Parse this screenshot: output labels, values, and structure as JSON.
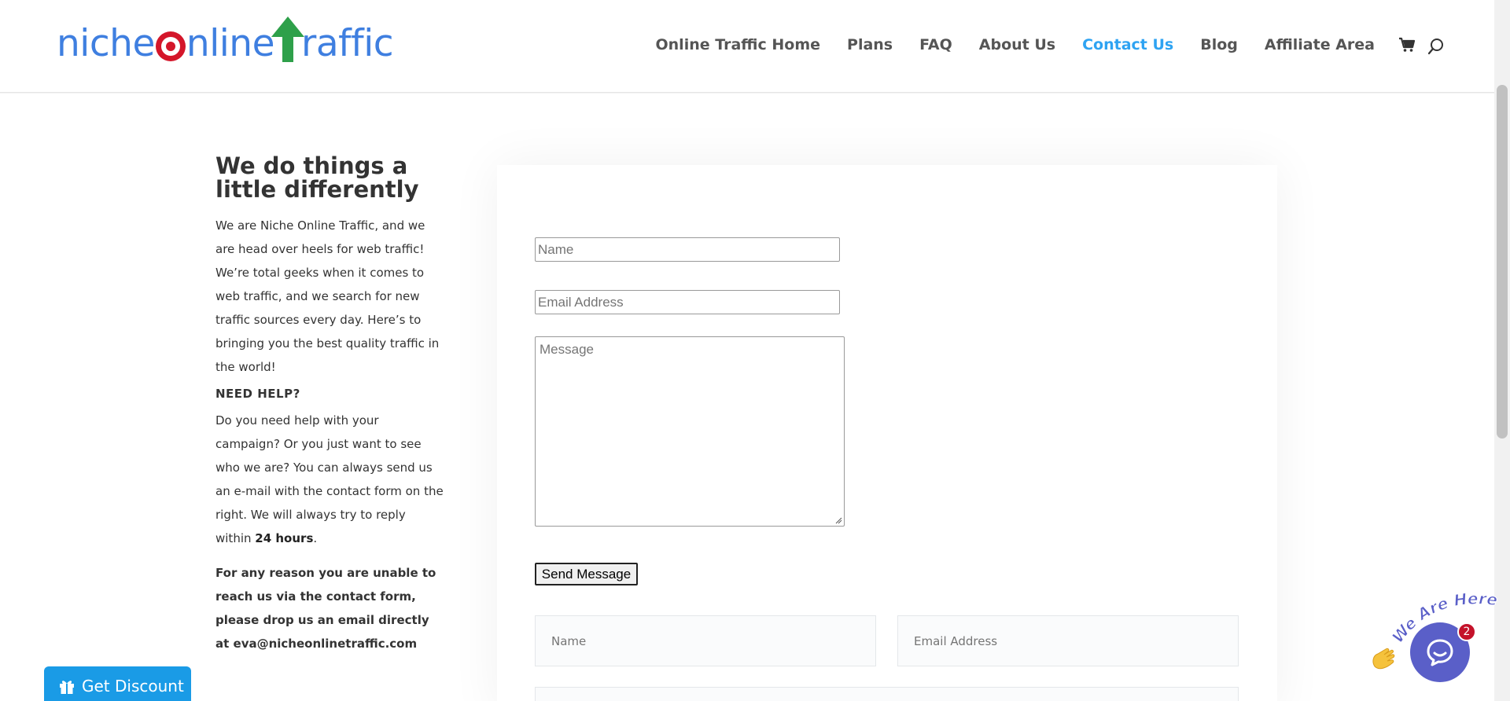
{
  "header": {
    "logo_text": "nicheonlinetraffic",
    "nav": [
      {
        "label": "Online Traffic Home",
        "active": false
      },
      {
        "label": "Plans",
        "active": false
      },
      {
        "label": "FAQ",
        "active": false
      },
      {
        "label": "About Us",
        "active": false
      },
      {
        "label": "Contact Us",
        "active": true
      },
      {
        "label": "Blog",
        "active": false
      },
      {
        "label": "Affiliate Area",
        "active": false
      }
    ],
    "cart_icon": "cart-icon",
    "search_icon": "search-icon"
  },
  "left": {
    "title": "We do things a little differently",
    "intro": "We are Niche Online Traffic, and we are head over heels for web traffic! We’re total geeks when it comes to web traffic, and we search for new traffic sources every day. Here’s to bringing you the best quality traffic in the world!",
    "need_help_heading": "NEED HELP?",
    "help_text_before": "Do you need help with your campaign? Or you just want to see who we are? You can always send us an e-mail with the contact form on the right. We will always try to reply within ",
    "help_text_bold": "24 hours",
    "help_text_after": ".",
    "bold_note": "For any reason you are unable to reach us via the contact form, please drop us an email directly at eva@nicheonlinetraffic.com"
  },
  "form": {
    "name_placeholder": "Name",
    "email_placeholder": "Email Address",
    "message_placeholder": "Message",
    "send_label": "Send Message"
  },
  "form2": {
    "name_placeholder": "Name",
    "email_placeholder": "Email Address"
  },
  "discount": {
    "label": "Get Discount",
    "icon": "gift-icon",
    "color": "#1a9be6"
  },
  "chat": {
    "banner": "We Are Here!",
    "badge_count": "2",
    "color": "#5a5fc8"
  },
  "colors": {
    "accent": "#2ea3f2",
    "logo_blue": "#3f7fe0",
    "logo_red": "#d4162a",
    "logo_green": "#2ea04a"
  }
}
